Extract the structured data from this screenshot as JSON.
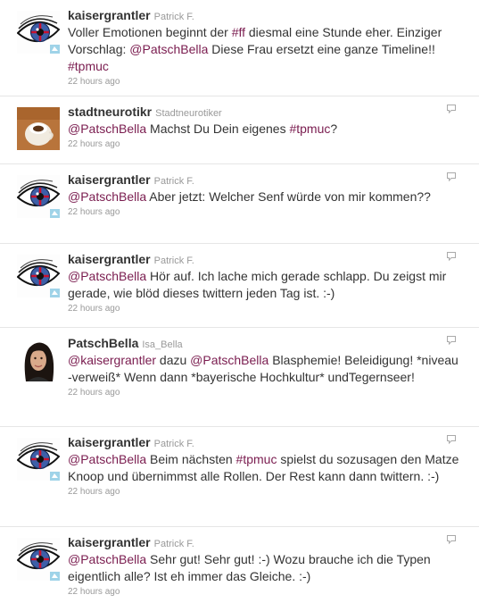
{
  "tweets": [
    {
      "screen_name": "kaisergrantler",
      "full_name": "Patrick F.",
      "avatar": "eye-avatar",
      "has_reply_icon": false,
      "time": "22 hours ago",
      "segments": [
        {
          "t": "Voller Emotionen beginnt der "
        },
        {
          "t": "#ff",
          "link": true
        },
        {
          "t": " diesmal eine Stunde eher. Einziger Vorschlag: "
        },
        {
          "t": "@PatschBella",
          "link": true
        },
        {
          "t": " Diese Frau ersetzt eine ganze Timeline!! "
        },
        {
          "t": "#tpmuc",
          "link": true
        }
      ]
    },
    {
      "screen_name": "stadtneurotikr",
      "full_name": "Stadtneurotiker",
      "avatar": "cup-avatar",
      "has_reply_icon": true,
      "time": "22 hours ago",
      "segments": [
        {
          "t": "@PatschBella",
          "link": true
        },
        {
          "t": " Machst Du Dein eigenes "
        },
        {
          "t": "#tpmuc",
          "link": true
        },
        {
          "t": "?"
        }
      ]
    },
    {
      "screen_name": "kaisergrantler",
      "full_name": "Patrick F.",
      "avatar": "eye-avatar",
      "has_reply_icon": true,
      "time": "22 hours ago",
      "segments": [
        {
          "t": "@PatschBella",
          "link": true
        },
        {
          "t": " Aber jetzt: Welcher Senf würde von mir kommen??"
        }
      ]
    },
    {
      "screen_name": "kaisergrantler",
      "full_name": "Patrick F.",
      "avatar": "eye-avatar",
      "has_reply_icon": true,
      "time": "22 hours ago",
      "segments": [
        {
          "t": "@PatschBella",
          "link": true
        },
        {
          "t": " Hör auf. Ich lache mich gerade schlapp. Du zeigst mir gerade, wie blöd dieses twittern jeden Tag ist. :-)"
        }
      ]
    },
    {
      "screen_name": "PatschBella",
      "full_name": "Isa_Bella",
      "avatar": "woman-avatar",
      "has_reply_icon": true,
      "time": "22 hours ago",
      "segments": [
        {
          "t": "@kaisergrantler",
          "link": true
        },
        {
          "t": " dazu "
        },
        {
          "t": "@PatschBella",
          "link": true
        },
        {
          "t": " Blasphemie! Beleidigung! *niveau -verweiß* Wenn dann *bayerische Hochkultur* undTegernseer!"
        }
      ]
    },
    {
      "screen_name": "kaisergrantler",
      "full_name": "Patrick F.",
      "avatar": "eye-avatar",
      "has_reply_icon": true,
      "time": "22 hours ago",
      "segments": [
        {
          "t": "@PatschBella",
          "link": true
        },
        {
          "t": " Beim nächsten "
        },
        {
          "t": "#tpmuc",
          "link": true
        },
        {
          "t": " spielst du sozusagen den Matze Knoop und übernimmst alle Rollen. Der Rest kann dann twittern. :-)"
        }
      ]
    },
    {
      "screen_name": "kaisergrantler",
      "full_name": "Patrick F.",
      "avatar": "eye-avatar",
      "has_reply_icon": true,
      "time": "22 hours ago",
      "segments": [
        {
          "t": "@PatschBella",
          "link": true
        },
        {
          "t": " Sehr gut! Sehr gut! :-) Wozu brauche ich die Typen eigentlich alle? Ist eh immer das Gleiche. :-)"
        }
      ]
    }
  ],
  "colors": {
    "link": "#7a1c4f",
    "meta": "#999999",
    "divider": "#e6e6e6"
  }
}
